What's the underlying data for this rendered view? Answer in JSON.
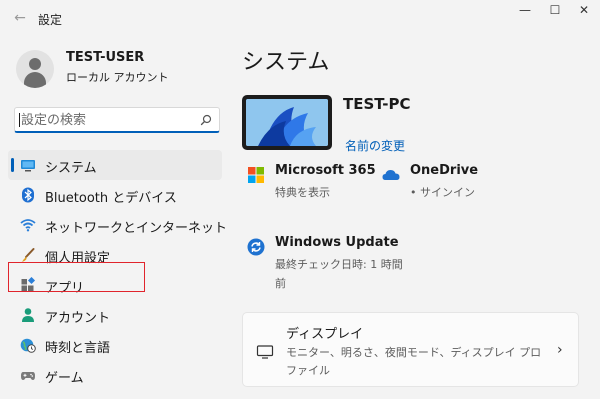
{
  "titlebar": {
    "back_icon": "arrow-left-icon",
    "title": "設定",
    "minimize_symbol": "—",
    "maximize_symbol": "☐",
    "close_symbol": "✕"
  },
  "user": {
    "name": "TEST-USER",
    "account_type": "ローカル アカウント"
  },
  "search": {
    "placeholder": "設定の検索",
    "value": ""
  },
  "nav": {
    "items": [
      {
        "label": "システム",
        "icon": "display-icon",
        "selected": true
      },
      {
        "label": "Bluetooth とデバイス",
        "icon": "bluetooth-icon"
      },
      {
        "label": "ネットワークとインターネット",
        "icon": "wifi-icon"
      },
      {
        "label": "個人用設定",
        "icon": "brush-icon"
      },
      {
        "label": "アプリ",
        "icon": "apps-icon"
      },
      {
        "label": "アカウント",
        "icon": "person-icon",
        "highlighted": true
      },
      {
        "label": "時刻と言語",
        "icon": "globe-clock-icon"
      },
      {
        "label": "ゲーム",
        "icon": "gamepad-icon"
      }
    ]
  },
  "main": {
    "title": "システム",
    "pc_name": "TEST-PC",
    "rename_link": "名前の変更",
    "tiles": {
      "ms365": {
        "title": "Microsoft 365",
        "subtitle": "特典を表示",
        "icon": "microsoft-logo-icon"
      },
      "onedrive": {
        "title": "OneDrive",
        "subtitle": "• サインイン",
        "icon": "cloud-icon"
      },
      "update": {
        "title": "Windows Update",
        "subtitle_line1": "最終チェック日時: 1 時間",
        "subtitle_line2": "前",
        "icon": "sync-icon"
      }
    },
    "display_card": {
      "title": "ディスプレイ",
      "description": "モニター、明るさ、夜間モード、ディスプレイ プロファイル",
      "icon": "monitor-icon",
      "chevron": "›"
    }
  },
  "colors": {
    "accent": "#005fb8",
    "highlight_box": "#e0242c",
    "background": "#f3f3f3"
  }
}
